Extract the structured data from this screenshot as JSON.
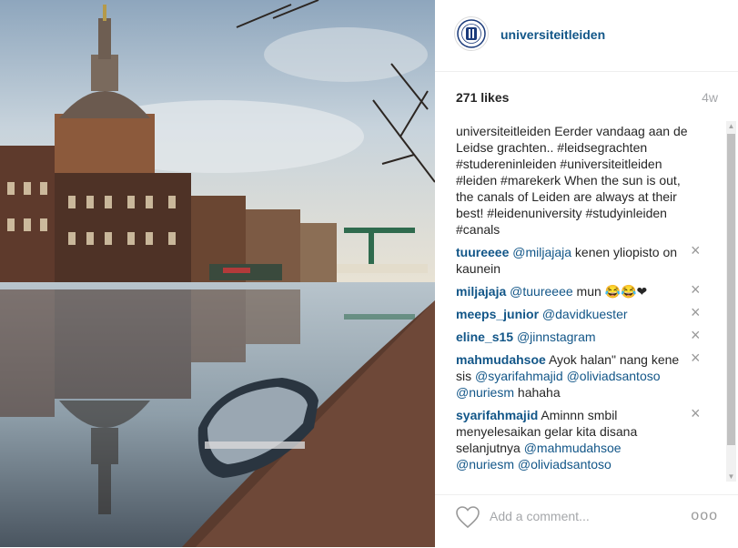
{
  "post": {
    "username": "universiteitleiden",
    "likes": "271 likes",
    "time": "4w",
    "caption": {
      "parts": [
        {
          "text": "Eerder vandaag aan de Leidse grachten.. ",
          "tag": false
        },
        {
          "text": "#leidsegrachten",
          "tag": true
        },
        {
          "text": " ",
          "tag": false
        },
        {
          "text": "#studereninleiden",
          "tag": true
        },
        {
          "text": " ",
          "tag": false
        },
        {
          "text": "#universiteitleiden",
          "tag": true
        },
        {
          "text": " ",
          "tag": false
        },
        {
          "text": "#leiden",
          "tag": true
        },
        {
          "text": " ",
          "tag": false
        },
        {
          "text": "#marekerk",
          "tag": true
        },
        {
          "text": " When the sun is out, the canals of Leiden are always at their best! ",
          "tag": false
        },
        {
          "text": "#leidenuniversity",
          "tag": true
        },
        {
          "text": " ",
          "tag": false
        },
        {
          "text": "#studyinleiden",
          "tag": true
        },
        {
          "text": " ",
          "tag": false
        },
        {
          "text": "#canals",
          "tag": true
        }
      ]
    }
  },
  "comments": [
    {
      "user": "tuureeee",
      "parts": [
        {
          "text": "@miljajaja",
          "tag": true
        },
        {
          "text": " kenen yliopisto on kaunein",
          "tag": false
        }
      ]
    },
    {
      "user": "miljajaja",
      "parts": [
        {
          "text": "@tuureeee",
          "tag": true
        },
        {
          "text": " mun 😂😂❤",
          "tag": false
        }
      ]
    },
    {
      "user": "meeps_junior",
      "parts": [
        {
          "text": "@davidkuester",
          "tag": true
        }
      ]
    },
    {
      "user": "eline_s15",
      "parts": [
        {
          "text": "@jinnstagram",
          "tag": true
        }
      ]
    },
    {
      "user": "mahmudahsoe",
      "parts": [
        {
          "text": "Ayok halan\" nang kene sis ",
          "tag": false
        },
        {
          "text": "@syarifahmajid",
          "tag": true
        },
        {
          "text": " ",
          "tag": false
        },
        {
          "text": "@oliviadsantoso",
          "tag": true
        },
        {
          "text": " ",
          "tag": false
        },
        {
          "text": "@nuriesm",
          "tag": true
        },
        {
          "text": " hahaha",
          "tag": false
        }
      ]
    },
    {
      "user": "syarifahmajid",
      "parts": [
        {
          "text": "Aminnn smbil menyelesaikan gelar kita disana selanjutnya ",
          "tag": false
        },
        {
          "text": "@mahmudahsoe",
          "tag": true
        },
        {
          "text": " ",
          "tag": false
        },
        {
          "text": "@nuriesm",
          "tag": true
        },
        {
          "text": " ",
          "tag": false
        },
        {
          "text": "@oliviadsantoso",
          "tag": true
        }
      ]
    }
  ],
  "footer": {
    "placeholder": "Add a comment...",
    "more": "ooo"
  },
  "icons": {
    "close": "×",
    "scroll_up": "▲",
    "scroll_down": "▼"
  },
  "colors": {
    "username": "#125688",
    "muted": "#a5a7aa"
  }
}
